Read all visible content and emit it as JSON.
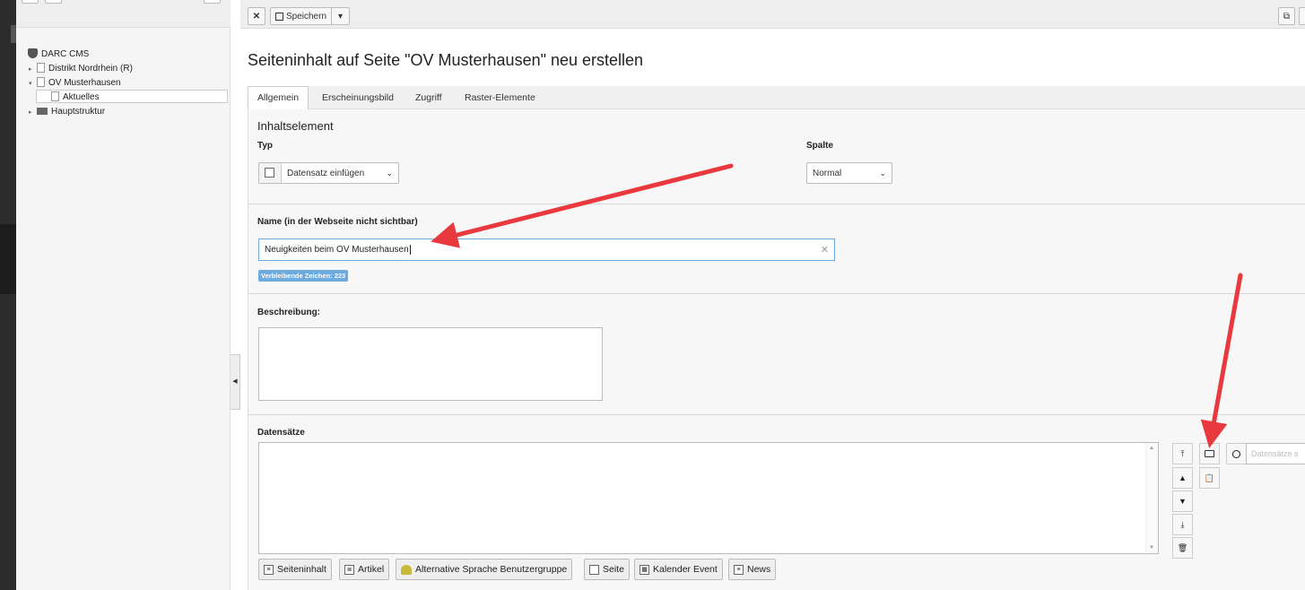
{
  "tree": {
    "root": "DARC CMS",
    "items": [
      "Distrikt Nordrhein (R)",
      "OV Musterhausen",
      "Aktuelles",
      "Hauptstruktur"
    ]
  },
  "toolbar": {
    "close": "✕",
    "save": "Speichern",
    "save_dropdown": "▾",
    "open_new": "⧉"
  },
  "title": "Seiteninhalt auf Seite \"OV Musterhausen\" neu erstellen",
  "tabs": [
    "Allgemein",
    "Erscheinungsbild",
    "Zugriff",
    "Raster-Elemente"
  ],
  "section": "Inhaltselement",
  "typ": {
    "label": "Typ",
    "value": "Datensatz einfügen"
  },
  "spalte": {
    "label": "Spalte",
    "value": "Normal"
  },
  "name_field": {
    "label": "Name (in der Webseite nicht sichtbar)",
    "value": "Neuigkeiten beim OV Musterhausen",
    "remaining": "Verbleibende Zeichen: 223"
  },
  "beschreibung": {
    "label": "Beschreibung:"
  },
  "datensaetze": {
    "label": "Datensätze",
    "search_placeholder": "Datensätze s",
    "record_buttons": [
      "Seiteninhalt",
      "Artikel",
      "Alternative Sprache Benutzergruppe",
      "Seite",
      "Kalender Event",
      "News"
    ]
  },
  "colors": {
    "accent_badge": "#6daae0",
    "arrow": "#e8393f"
  }
}
